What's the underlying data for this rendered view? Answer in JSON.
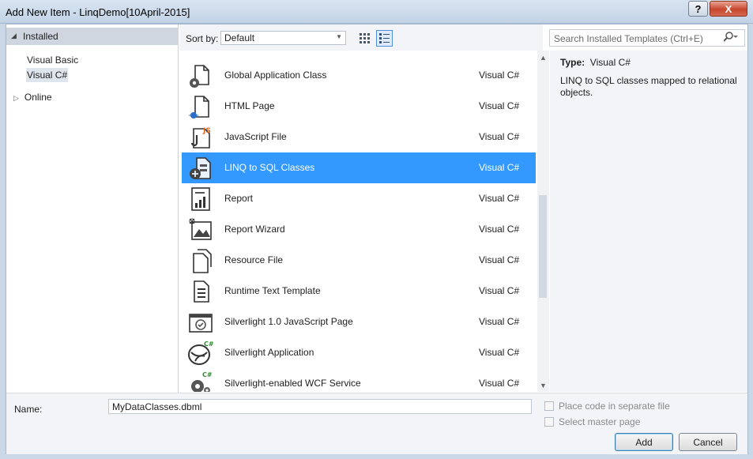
{
  "window": {
    "title": "Add New Item - LinqDemo[10April-2015]",
    "help_glyph": "?",
    "close_glyph": "X"
  },
  "tree": {
    "installed": "Installed",
    "children": [
      "Visual Basic",
      "Visual C#"
    ],
    "selected_child": "Visual C#",
    "online": "Online"
  },
  "toolbar": {
    "sort_label": "Sort by:",
    "sort_value": "Default"
  },
  "search": {
    "placeholder": "Search Installed Templates (Ctrl+E)"
  },
  "templates": [
    {
      "name": "Global Application Class",
      "lang": "Visual C#",
      "icon": "global-app-icon"
    },
    {
      "name": "HTML Page",
      "lang": "Visual C#",
      "icon": "html-page-icon"
    },
    {
      "name": "JavaScript File",
      "lang": "Visual C#",
      "icon": "javascript-icon"
    },
    {
      "name": "LINQ to SQL Classes",
      "lang": "Visual C#",
      "icon": "linq-sql-icon",
      "selected": true
    },
    {
      "name": "Report",
      "lang": "Visual C#",
      "icon": "report-icon"
    },
    {
      "name": "Report Wizard",
      "lang": "Visual C#",
      "icon": "report-wizard-icon"
    },
    {
      "name": "Resource File",
      "lang": "Visual C#",
      "icon": "resource-file-icon"
    },
    {
      "name": "Runtime Text Template",
      "lang": "Visual C#",
      "icon": "text-template-icon"
    },
    {
      "name": "Silverlight 1.0 JavaScript Page",
      "lang": "Visual C#",
      "icon": "silverlight-page-icon"
    },
    {
      "name": "Silverlight Application",
      "lang": "Visual C#",
      "icon": "silverlight-app-icon"
    },
    {
      "name": "Silverlight-enabled WCF Service",
      "lang": "Visual C#",
      "icon": "wcf-service-icon"
    }
  ],
  "details": {
    "type_label": "Type:",
    "type_value": "Visual C#",
    "description": "LINQ to SQL classes mapped to relational objects."
  },
  "bottom": {
    "name_label": "Name:",
    "name_value": "MyDataClasses.dbml",
    "place_code": "Place code in separate file",
    "master_page": "Select master page",
    "add": "Add",
    "cancel": "Cancel"
  },
  "colors": {
    "selection": "#3399ff",
    "panel": "#f2f4f7",
    "frame": "#c9d7e7"
  }
}
